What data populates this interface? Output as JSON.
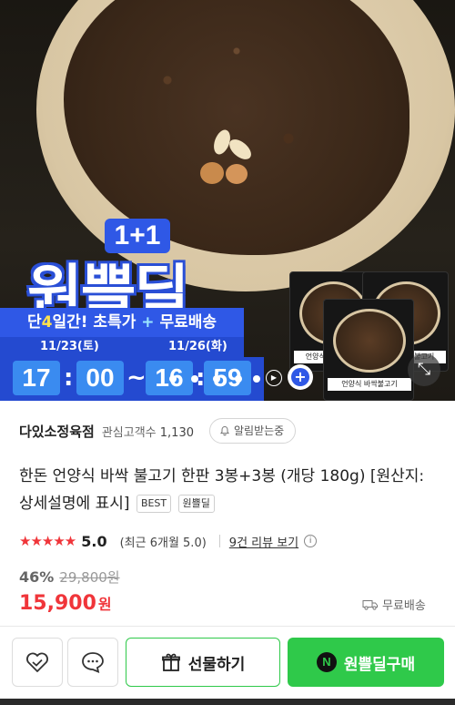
{
  "hero": {
    "badge_top": "1+1",
    "badge_title": "원쁠딜",
    "promo_prefix": "단",
    "promo_days": "4",
    "promo_suffix": "일간! 초특가",
    "promo_plus": "+",
    "promo_free": "무료배송",
    "start_date": "11/23(토)",
    "end_date": "11/26(화)",
    "timer": {
      "h": "17",
      "m": "00",
      "sep": "~",
      "h2": "16",
      "m2": "59"
    },
    "package_label": "언양식 바싹불고기",
    "colors": {
      "promo_blue": "#2f58e6",
      "highlight_yellow": "#ffe14d"
    }
  },
  "seller": {
    "name": "다있소정육점",
    "follow_label": "관심고객수",
    "follow_count": "1,130",
    "alert_label": "알림받는중"
  },
  "product": {
    "title": "한돈 언양식 바싹 불고기 한판 3봉+3봉 (개당 180g) [원산지:상세설명에 표시]",
    "tags": [
      "BEST",
      "원쁠딜"
    ]
  },
  "rating": {
    "stars": "★★★★★",
    "score": "5.0",
    "recent": "(최근 6개월 5.0)",
    "review_link": "9건 리뷰 보기",
    "info": "i"
  },
  "price": {
    "discount": "46%",
    "original": "29,800원",
    "current": "15,900",
    "currency": "원",
    "shipping": "무료배송"
  },
  "bottom": {
    "gift_label": "선물하기",
    "buy_logo": "N",
    "buy_label": "원쁠딜구매",
    "accent": "#2fc94a"
  }
}
